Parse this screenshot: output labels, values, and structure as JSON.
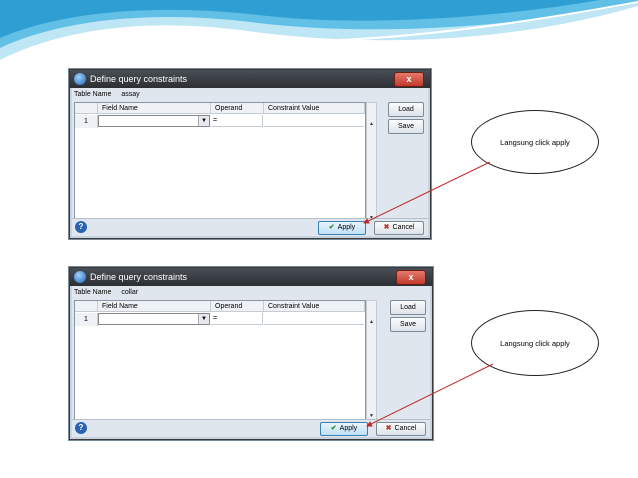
{
  "dialogs": [
    {
      "title": "Define query constraints",
      "close_label": "x",
      "table_name_label": "Table Name",
      "table_name_value": "assay",
      "columns": [
        "Field Name",
        "Operand",
        "Constraint Value"
      ],
      "row_number": "1",
      "operand_value": "=",
      "load_label": "Load",
      "save_label": "Save",
      "apply_label": "Apply",
      "cancel_label": "Cancel"
    },
    {
      "title": "Define query constraints",
      "close_label": "x",
      "table_name_label": "Table Name",
      "table_name_value": "collar",
      "columns": [
        "Field Name",
        "Operand",
        "Constraint Value"
      ],
      "row_number": "1",
      "operand_value": "=",
      "load_label": "Load",
      "save_label": "Save",
      "apply_label": "Apply",
      "cancel_label": "Cancel"
    }
  ],
  "callouts": [
    {
      "text": "Langsung click apply"
    },
    {
      "text": "Langsung click apply"
    }
  ],
  "colors": {
    "arrow": "#c0282b",
    "wave": "#3aa6d6"
  }
}
